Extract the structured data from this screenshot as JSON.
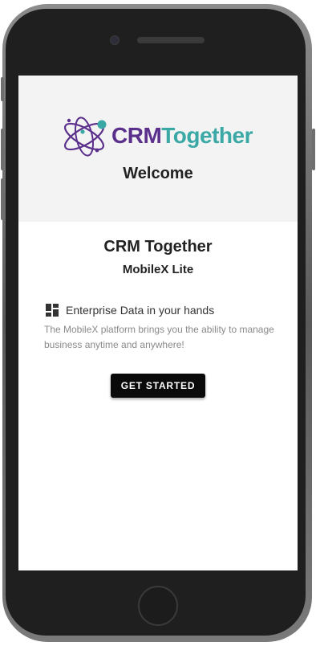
{
  "brand": {
    "name_part1": "CRM",
    "name_part2": "Together",
    "color_primary": "#5b2f8c",
    "color_secondary": "#3aa9a6",
    "logo_icon": "atom-orbit-icon"
  },
  "header": {
    "welcome": "Welcome"
  },
  "main": {
    "title": "CRM Together",
    "subtitle": "MobileX Lite",
    "feature": {
      "icon": "dashboard-icon",
      "heading": "Enterprise Data in your hands",
      "description": "The MobileX platform brings you the ability to manage business anytime and anywhere!"
    },
    "cta_label": "GET STARTED"
  },
  "colors": {
    "header_bg": "#f3f3f3",
    "screen_bg": "#ffffff",
    "button_bg": "#0a0a0a",
    "button_text": "#ffffff"
  }
}
